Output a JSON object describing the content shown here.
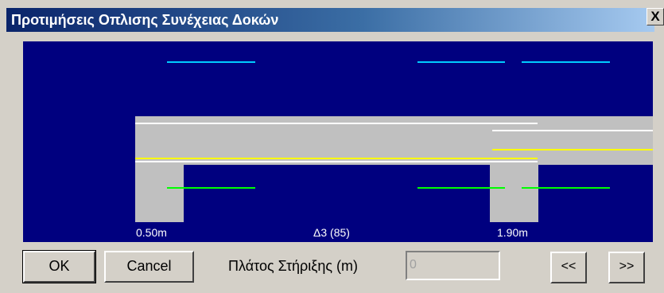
{
  "window": {
    "title": "Προτιμήσεις Οπλισης Συνέχειας Δοκών",
    "close_label": "X"
  },
  "canvas": {
    "labels": {
      "left_support": "0.50m",
      "beam": "Δ3 (85)",
      "right_support": "1.90m"
    },
    "colors": {
      "background": "#00007f",
      "section": "#c0c0c0",
      "top_bars": "#00ccff",
      "bottom_bars": "#00ff00",
      "rebar_white": "#ffffff",
      "rebar_yellow": "#ffff00"
    }
  },
  "footer": {
    "ok_label": "OK",
    "cancel_label": "Cancel",
    "width_label": "Πλάτος Στήριξης (m)",
    "width_value": "0",
    "prev_label": "<<",
    "next_label": ">>"
  }
}
